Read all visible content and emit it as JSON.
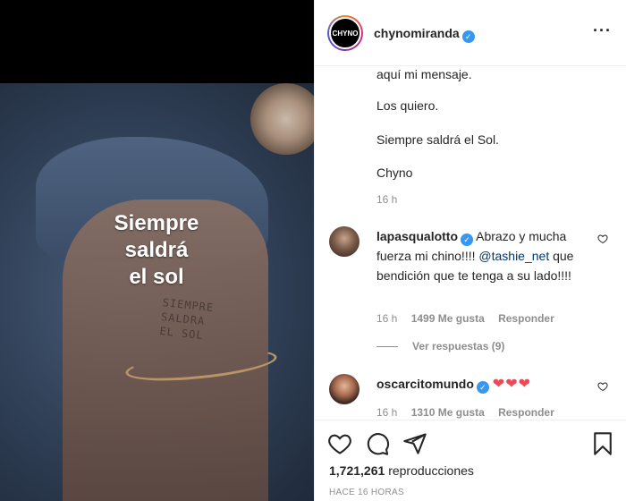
{
  "media": {
    "overlay_lines": [
      "Siempre",
      "saldrá",
      "el sol"
    ],
    "tattoo_lines": [
      "SIEMPRE",
      "SALDRA",
      "EL SOL"
    ]
  },
  "header": {
    "avatar_text": "CHYNO",
    "username": "chynomiranda",
    "verified": true,
    "more_icon": "more-horizontal-icon"
  },
  "caption": {
    "lines": [
      "aquí mi mensaje.",
      "Los quiero.",
      "Siempre saldrá el Sol.",
      "Chyno"
    ],
    "age": "16 h"
  },
  "comments": [
    {
      "username": "lapasqualotto",
      "verified": true,
      "text_before": " Abrazo y mucha fuerza mi chino!!!! ",
      "mention": "@tashie_net",
      "text_after": " que bendición que te tenga a su lado!!!!",
      "age": "16 h",
      "likes": "1499 Me gusta",
      "reply": "Responder",
      "view_replies": "Ver respuestas (9)"
    },
    {
      "username": "oscarcitomundo",
      "verified": true,
      "text": "❤❤❤",
      "age": "16 h",
      "likes": "1310 Me gusta",
      "reply": "Responder"
    }
  ],
  "footer": {
    "views_count": "1,721,261",
    "views_label": "reproducciones",
    "posted": "HACE 16 HORAS"
  },
  "colors": {
    "link": "#00376b",
    "verified": "#3897f0",
    "heart": "#ed4956",
    "muted": "#8e8e8e"
  }
}
